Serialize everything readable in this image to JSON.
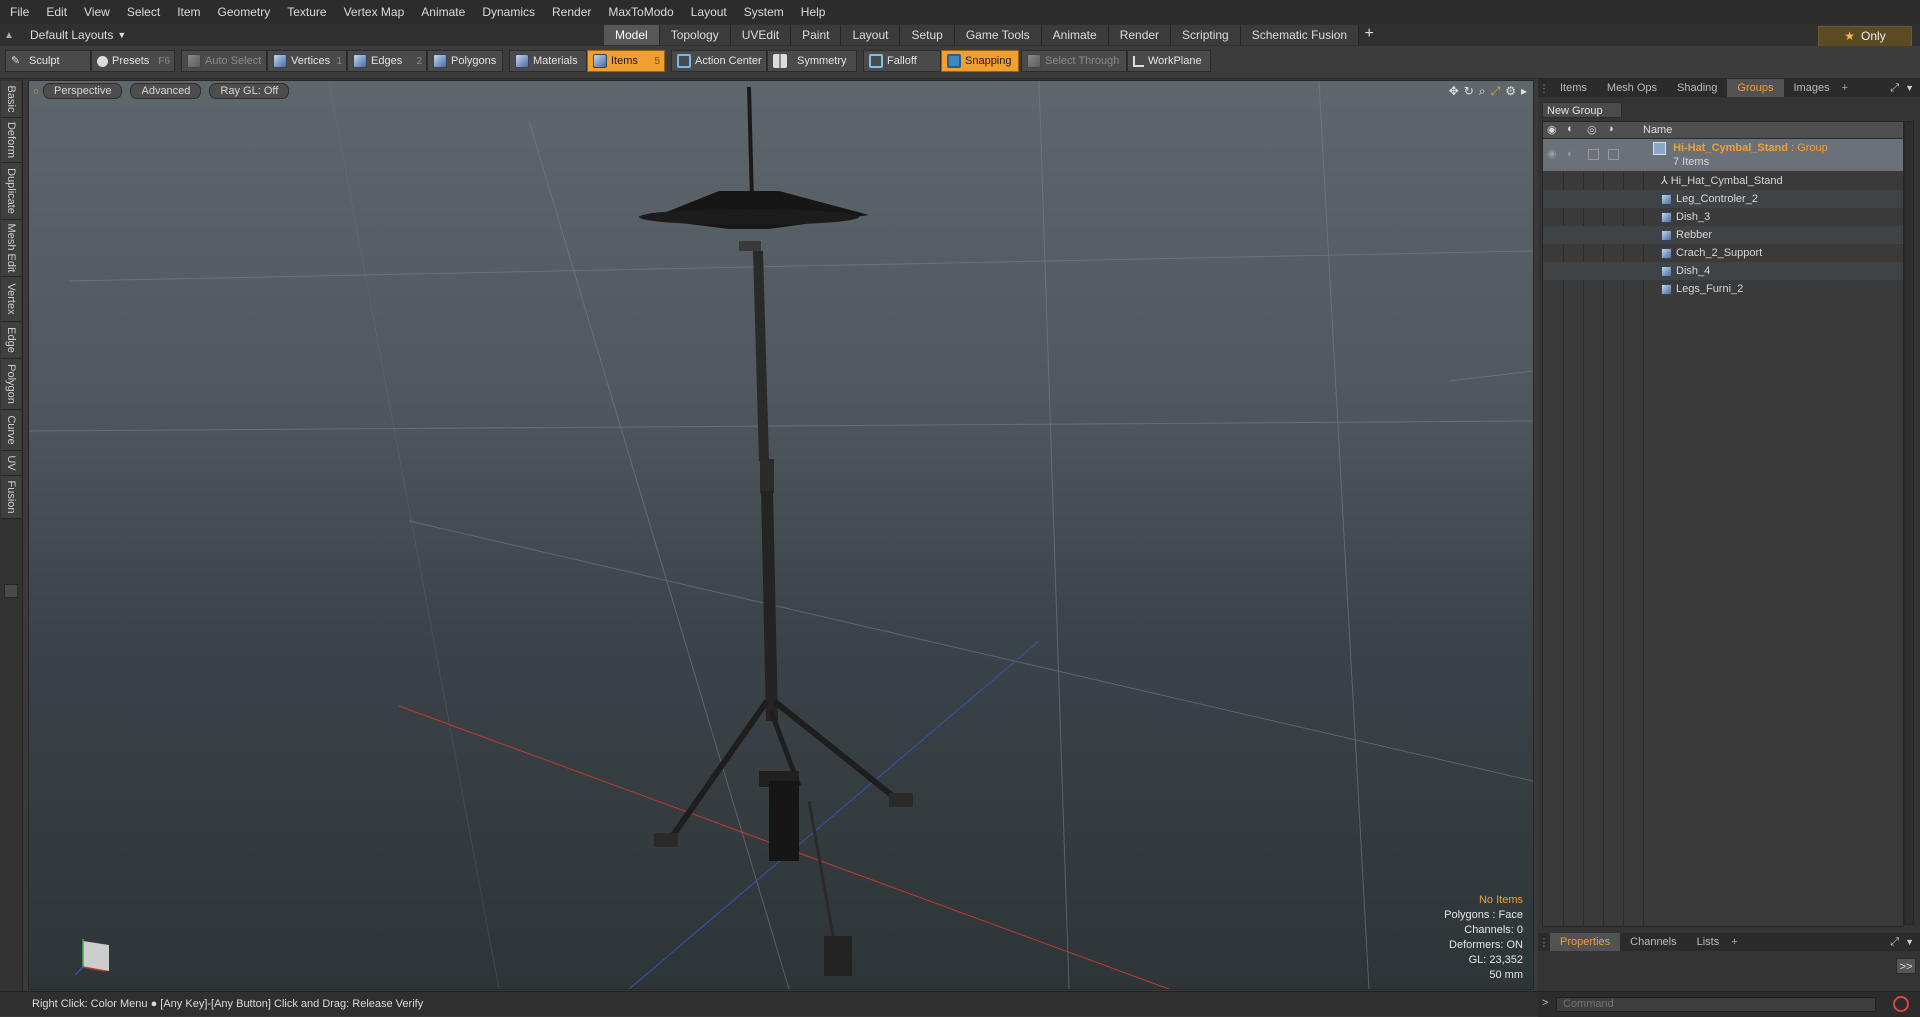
{
  "menu": [
    "File",
    "Edit",
    "View",
    "Select",
    "Item",
    "Geometry",
    "Texture",
    "Vertex Map",
    "Animate",
    "Dynamics",
    "Render",
    "MaxToModo",
    "Layout",
    "System",
    "Help"
  ],
  "layout": {
    "selector": "Default Layouts",
    "tabs": [
      "Model",
      "Topology",
      "UVEdit",
      "Paint",
      "Layout",
      "Setup",
      "Game Tools",
      "Animate",
      "Render",
      "Scripting",
      "Schematic Fusion"
    ],
    "active_tab": "Model",
    "only_label": "Only"
  },
  "toolbar": {
    "sculpt": "Sculpt",
    "presets": "Presets",
    "presets_key": "F6",
    "auto_select": "Auto Select",
    "vertices": "Vertices",
    "vertices_num": "1",
    "edges": "Edges",
    "edges_num": "2",
    "polygons": "Polygons",
    "materials": "Materials",
    "items": "Items",
    "items_num": "5",
    "action_center": "Action Center",
    "symmetry": "Symmetry",
    "falloff": "Falloff",
    "snapping": "Snapping",
    "select_through": "Select Through",
    "workplane": "WorkPlane"
  },
  "left_tabs": [
    "Basic",
    "Deform",
    "Duplicate",
    "Mesh Edit",
    "Vertex",
    "Edge",
    "Polygon",
    "Curve",
    "UV",
    "Fusion"
  ],
  "viewport": {
    "view": "Perspective",
    "mode": "Advanced",
    "raygl": "Ray GL: Off",
    "info": {
      "selection": "No Items",
      "polygons": "Polygons : Face",
      "channels": "Channels: 0",
      "deformers": "Deformers: ON",
      "gl": "GL: 23,352",
      "focal": "50 mm"
    }
  },
  "right_panel": {
    "tabs": [
      "Items",
      "Mesh Ops",
      "Shading",
      "Groups",
      "Images"
    ],
    "active_tab": "Groups",
    "new_group": "New Group",
    "column_name": "Name",
    "group": {
      "name": "Hi-Hat_Cymbal_Stand",
      "type": ": Group",
      "count": "7 Items"
    },
    "items": [
      "Hi_Hat_Cymbal_Stand",
      "Leg_Controler_2",
      "Dish_3",
      "Rebber",
      "Crach_2_Support",
      "Dish_4",
      "Legs_Furni_2"
    ],
    "bottom_tabs": [
      "Properties",
      "Channels",
      "Lists"
    ],
    "bottom_active": "Properties",
    "expand_label": ">>"
  },
  "status": {
    "text": "Right Click: Color Menu ● [Any Key]-[Any Button] Click and Drag: Release Verify"
  },
  "command": {
    "placeholder": "Command"
  },
  "colors": {
    "accent": "#f0a030",
    "x_axis": "#c0392b",
    "z_axis": "#3a4fb0"
  }
}
